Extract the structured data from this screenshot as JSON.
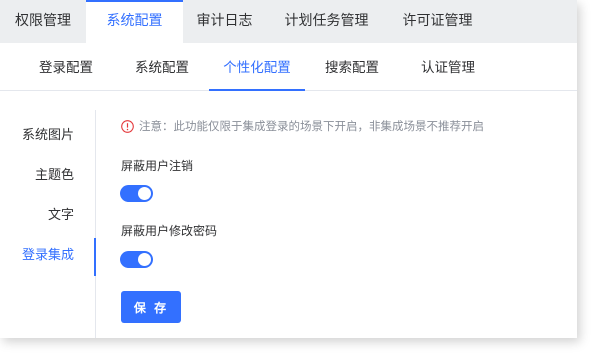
{
  "top_tabs": [
    {
      "label": "权限管理",
      "active": false
    },
    {
      "label": "系统配置",
      "active": true
    },
    {
      "label": "审计日志",
      "active": false
    },
    {
      "label": "计划任务管理",
      "active": false
    },
    {
      "label": "许可证管理",
      "active": false
    }
  ],
  "sub_tabs": [
    {
      "label": "登录配置",
      "active": false
    },
    {
      "label": "系统配置",
      "active": false
    },
    {
      "label": "个性化配置",
      "active": true
    },
    {
      "label": "搜索配置",
      "active": false
    },
    {
      "label": "认证管理",
      "active": false
    }
  ],
  "side_nav": [
    {
      "label": "系统图片",
      "active": false
    },
    {
      "label": "主题色",
      "active": false
    },
    {
      "label": "文字",
      "active": false
    },
    {
      "label": "登录集成",
      "active": true
    }
  ],
  "notice": {
    "icon": "warning-circle-icon",
    "text": "注意：此功能仅限于集成登录的场景下开启，非集成场景不推荐开启"
  },
  "settings": {
    "hide_logout": {
      "label": "屏蔽用户注销",
      "enabled": true
    },
    "hide_change_password": {
      "label": "屏蔽用户修改密码",
      "enabled": true
    }
  },
  "actions": {
    "save_label": "保 存"
  },
  "colors": {
    "accent": "#3370ff",
    "warning": "#e4393c",
    "tab_bar_bg": "#eceef0"
  }
}
